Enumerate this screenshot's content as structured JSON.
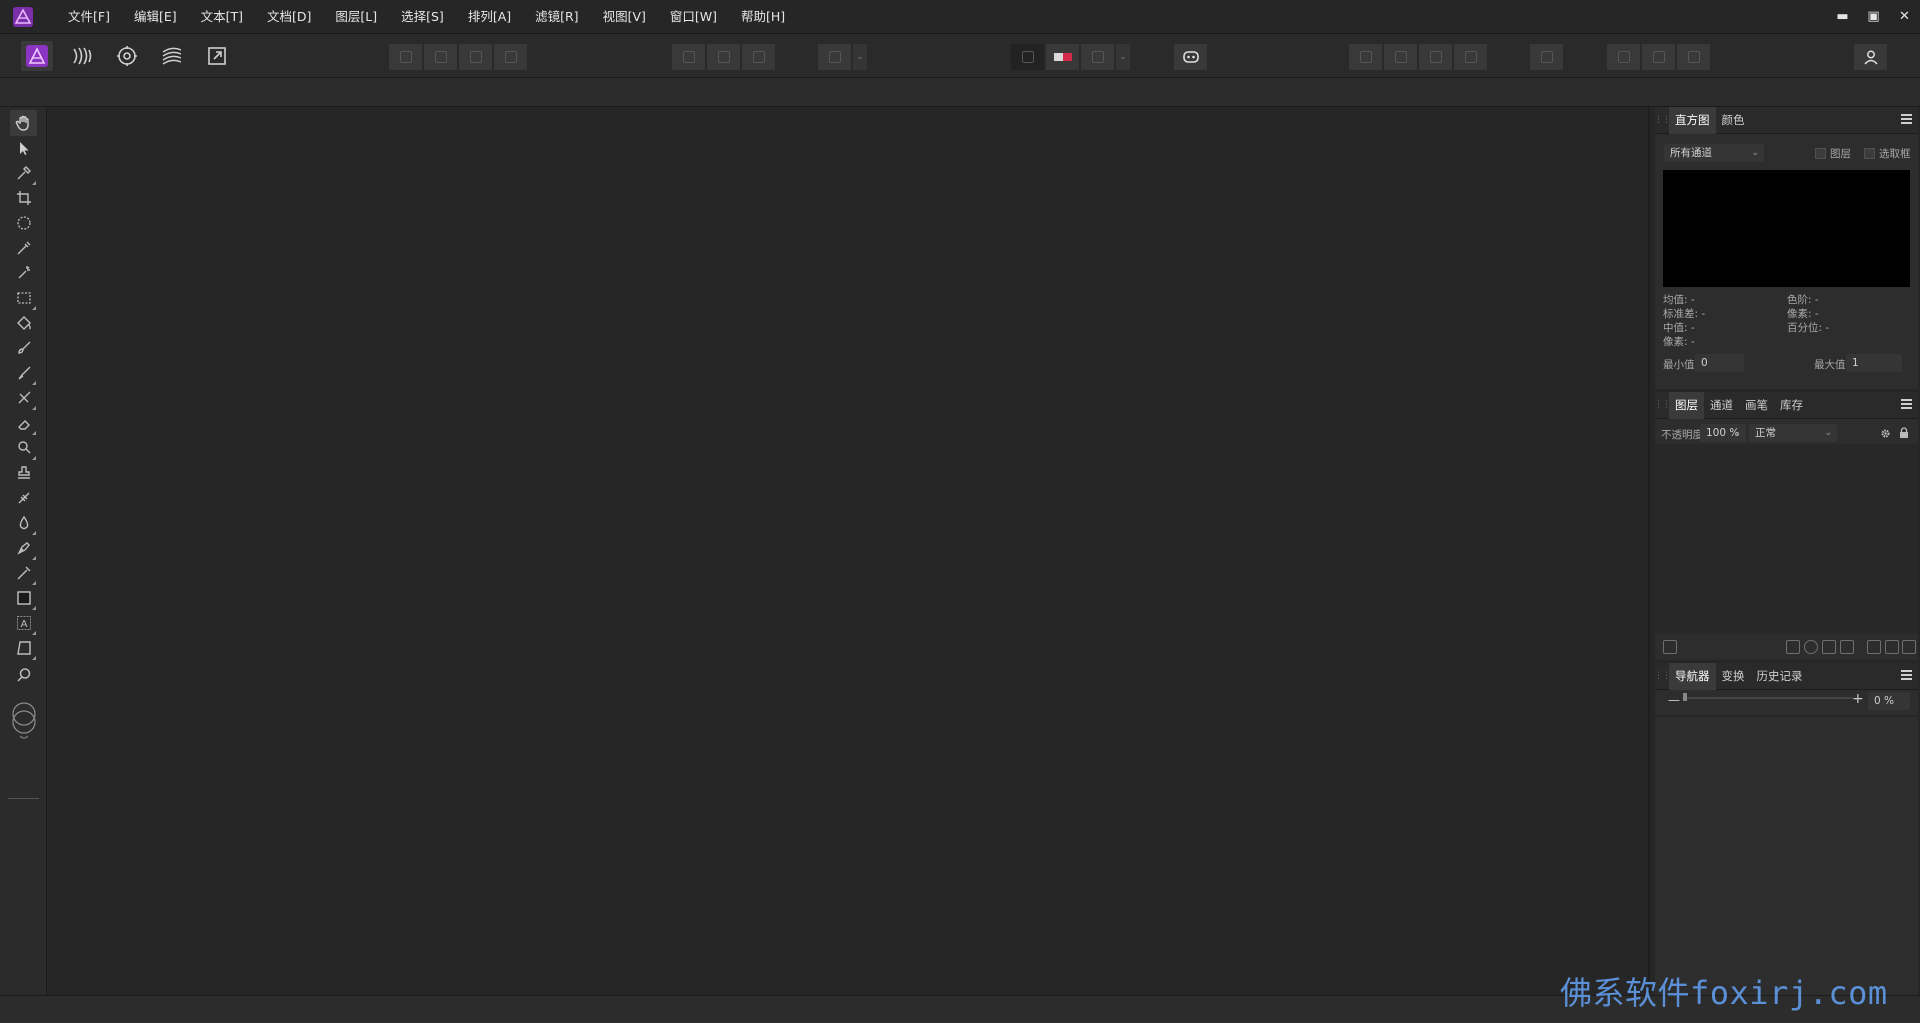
{
  "menubar": {
    "items": [
      "文件[F]",
      "编辑[E]",
      "文本[T]",
      "文档[D]",
      "图层[L]",
      "选择[S]",
      "排列[A]",
      "滤镜[R]",
      "视图[V]",
      "窗口[W]",
      "帮助[H]"
    ],
    "minimize": "▬",
    "maximize": "▣",
    "close": "✕"
  },
  "histogram_panel": {
    "tabs": [
      "直方图",
      "颜色"
    ],
    "channel_select": "所有通道",
    "checkbox_layer": "图层",
    "checkbox_selection": "选取框",
    "stats": {
      "mean": "均值: -",
      "std_dev": "标准差: -",
      "median": "中值: -",
      "pixels_left": "像素: -",
      "levels": "色阶: -",
      "pixels_right": "像素: -",
      "percentile": "百分位: -"
    },
    "min_label": "最小值:",
    "min_value": "0",
    "max_label": "最大值:",
    "max_value": "1"
  },
  "layers_panel": {
    "tabs": [
      "图层",
      "通道",
      "画笔",
      "库存"
    ],
    "opacity_label": "不透明度:",
    "opacity_value": "100 %",
    "blend_mode": "正常"
  },
  "navigator_panel": {
    "tabs": [
      "导航器",
      "变换",
      "历史记录"
    ],
    "zoom_value": "0 %",
    "minus": "—",
    "plus": "+"
  },
  "watermark": "佛系软件foxirj.com",
  "colors": {
    "accent": "#a23bd6",
    "watermark": "#5b8fd6"
  }
}
